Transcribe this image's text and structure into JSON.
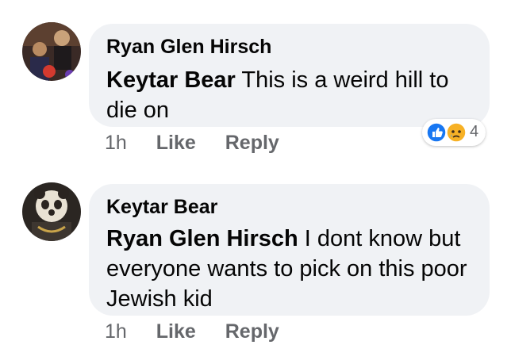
{
  "comments": [
    {
      "author": "Ryan Glen Hirsch",
      "mention": "Keytar Bear",
      "text": " This is a weird hill to die on",
      "time": "1h",
      "like_label": "Like",
      "reply_label": "Reply",
      "reaction_count": "4",
      "reactions": [
        "like-icon",
        "sad-icon"
      ]
    },
    {
      "author": "Keytar Bear",
      "mention": "Ryan Glen Hirsch",
      "text": " I dont know but everyone  wants to pick on this poor  Jewish kid",
      "time": "1h",
      "like_label": "Like",
      "reply_label": "Reply"
    }
  ],
  "colors": {
    "bubble": "#f0f2f5",
    "meta": "#65676b",
    "like_blue": "#1877f2",
    "sad_yellow": "#f7b125"
  }
}
